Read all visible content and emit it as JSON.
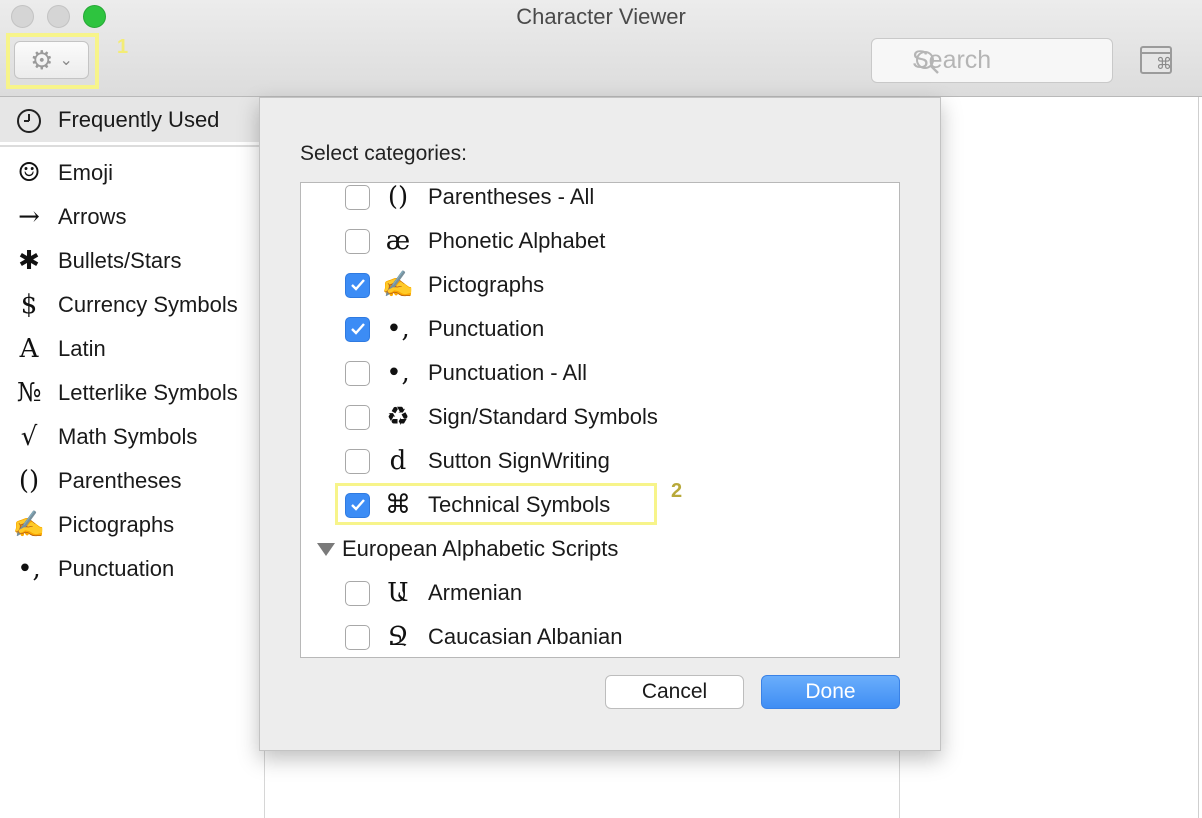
{
  "window": {
    "title": "Character Viewer"
  },
  "toolbar": {
    "search_placeholder": "Search",
    "gear_icon": "gear-icon",
    "annotation_1": "1"
  },
  "sidebar": {
    "frequently_used": {
      "icon": "🕘",
      "label": "Frequently Used"
    },
    "items": [
      {
        "icon": "☺",
        "label": "Emoji"
      },
      {
        "icon": "→",
        "label": "Arrows"
      },
      {
        "icon": "✱",
        "label": "Bullets/Stars"
      },
      {
        "icon": "$",
        "label": "Currency Symbols"
      },
      {
        "icon": "A",
        "label": "Latin"
      },
      {
        "icon": "№",
        "label": "Letterlike Symbols"
      },
      {
        "icon": "√",
        "label": "Math Symbols"
      },
      {
        "icon": "()",
        "label": "Parentheses"
      },
      {
        "icon": "✍",
        "label": "Pictographs"
      },
      {
        "icon": "•,",
        "label": "Punctuation"
      }
    ]
  },
  "dialog": {
    "title": "Select categories:",
    "categories": [
      {
        "icon": "()",
        "label": "Parentheses - All",
        "checked": false
      },
      {
        "icon": "æ",
        "label": "Phonetic Alphabet",
        "checked": false
      },
      {
        "icon": "✍",
        "label": "Pictographs",
        "checked": true
      },
      {
        "icon": "•,",
        "label": "Punctuation",
        "checked": true
      },
      {
        "icon": "•,",
        "label": "Punctuation - All",
        "checked": false
      },
      {
        "icon": "♻",
        "label": "Sign/Standard Symbols",
        "checked": false
      },
      {
        "icon": "d",
        "label": "Sutton SignWriting",
        "checked": false
      },
      {
        "icon": "⌘",
        "label": "Technical Symbols",
        "checked": true
      }
    ],
    "group": {
      "label": "European Alphabetic Scripts",
      "expanded": true
    },
    "group_items": [
      {
        "icon": "Ա",
        "label": "Armenian",
        "checked": false
      },
      {
        "icon": "Ջ",
        "label": "Caucasian Albanian",
        "checked": false
      }
    ],
    "annotation_2": "2",
    "cancel_label": "Cancel",
    "done_label": "Done"
  },
  "colors": {
    "accent": "#3c8cf5",
    "highlight": "#f7f48a"
  }
}
